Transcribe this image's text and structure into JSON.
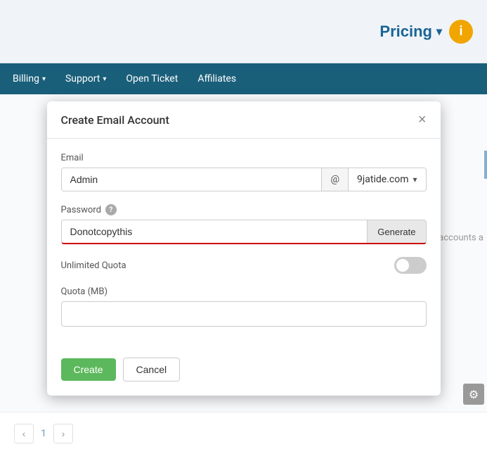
{
  "topBar": {
    "pricing_label": "Pricing",
    "info_icon": "i"
  },
  "navBar": {
    "items": [
      {
        "label": "Billing",
        "hasDropdown": true
      },
      {
        "label": "Support",
        "hasDropdown": true
      },
      {
        "label": "Open Ticket",
        "hasDropdown": false
      },
      {
        "label": "Affiliates",
        "hasDropdown": false
      }
    ]
  },
  "pagination": {
    "prev_label": "‹",
    "next_label": "›",
    "current_page": "1"
  },
  "modal": {
    "title": "Create Email Account",
    "close_label": "×",
    "email_label": "Email",
    "email_value": "Admin",
    "at_symbol": "@",
    "domain_value": "9jatide.com",
    "password_label": "Password",
    "password_value": "Donotcopythis",
    "generate_label": "Generate",
    "unlimited_quota_label": "Unlimited Quota",
    "quota_mb_label": "Quota (MB)",
    "quota_mb_value": "",
    "create_label": "Create",
    "cancel_label": "Cancel"
  },
  "background": {
    "hint_text": "ail accounts a"
  }
}
